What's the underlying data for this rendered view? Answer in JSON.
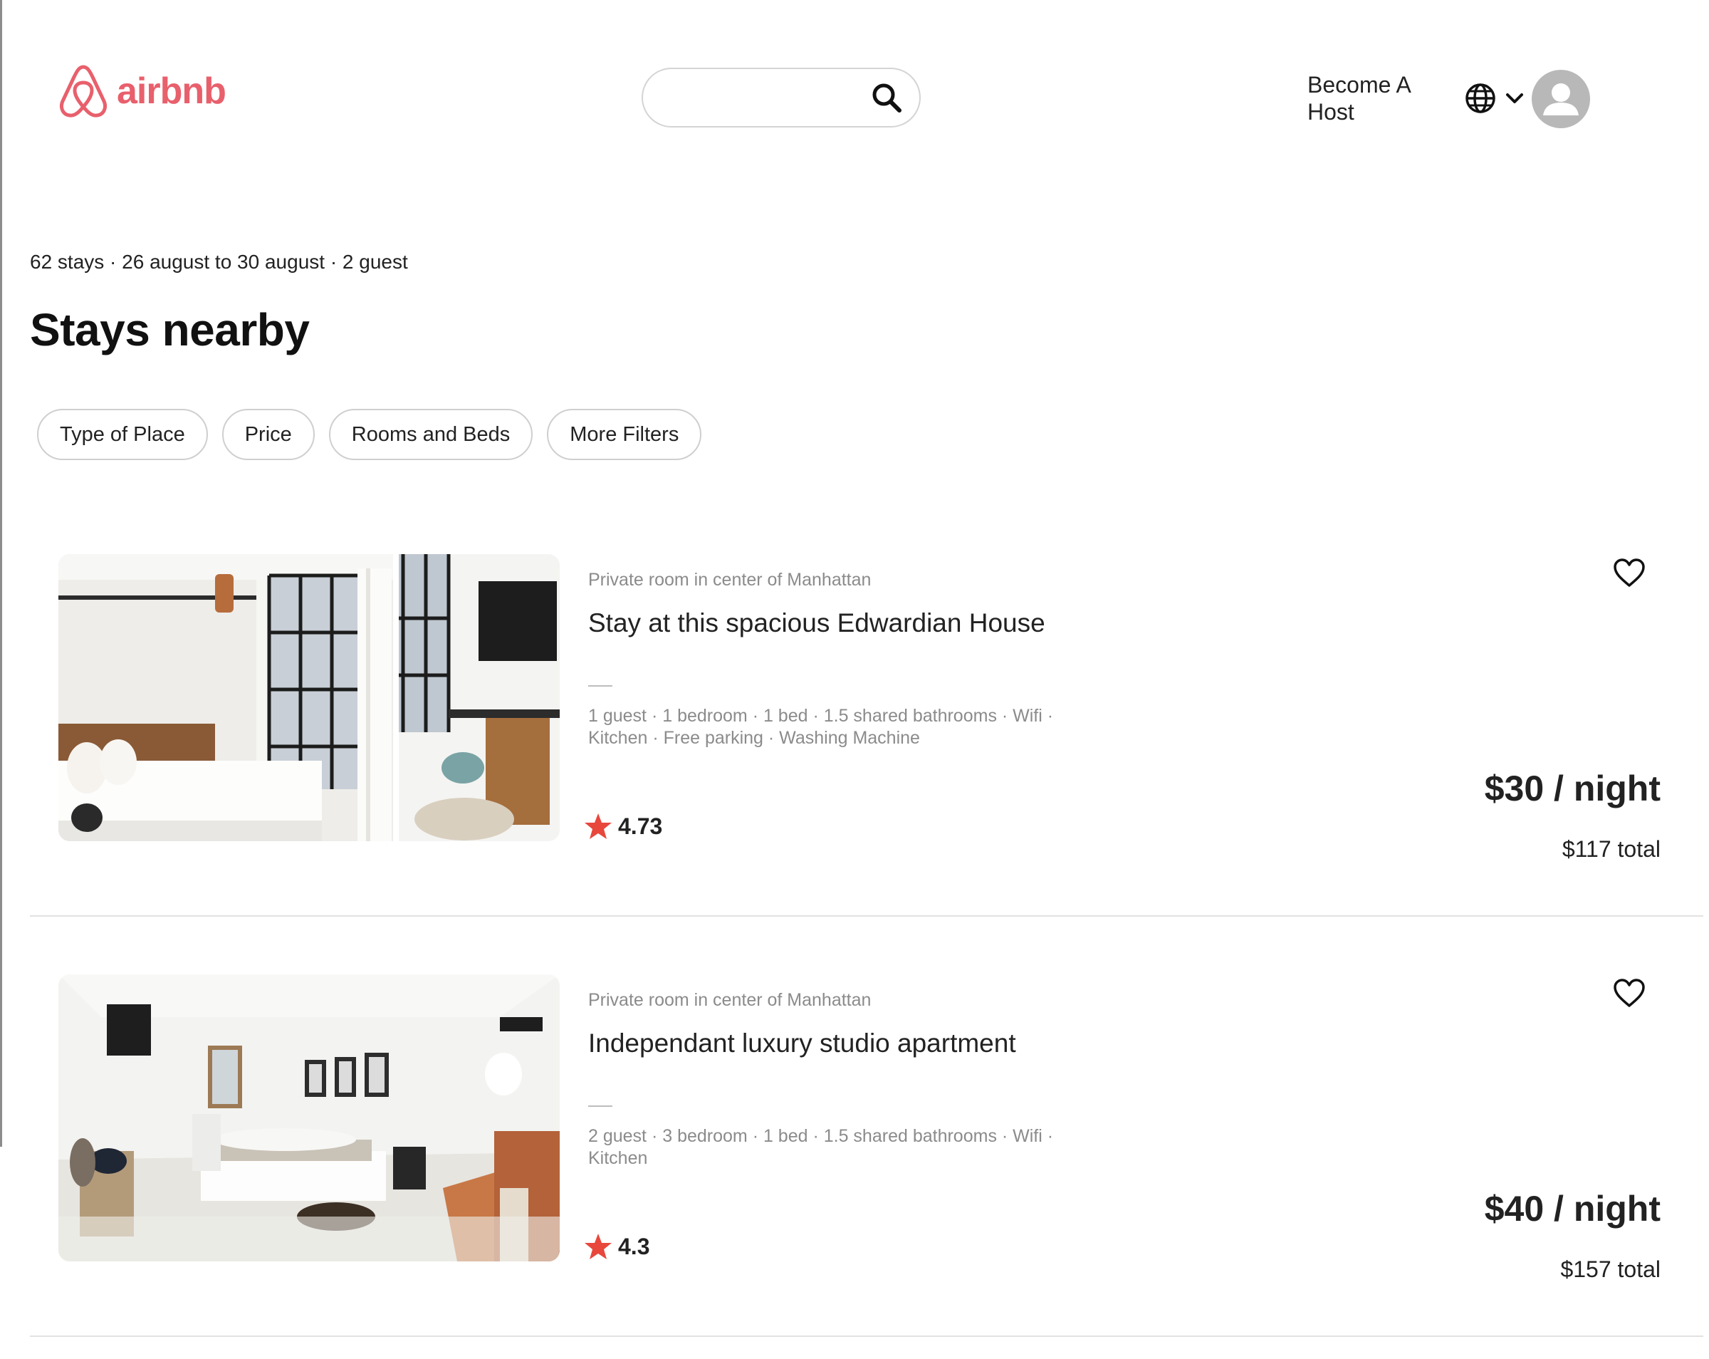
{
  "brand": {
    "name": "airbnb",
    "color": "#e8606c"
  },
  "header": {
    "search": {
      "placeholder": "",
      "icon": "search-icon"
    },
    "become_host": "Become A Host",
    "language_icon": "globe-icon",
    "menu_icon": "chevron-down-icon",
    "profile_icon": "avatar-icon"
  },
  "summary": "62 stays · 26 august to 30 august · 2 guest",
  "title": "Stays nearby",
  "filters": [
    "Type of Place",
    "Price",
    "Rooms and Beds",
    "More Filters"
  ],
  "listings": [
    {
      "type": "Private room in center of Manhattan",
      "title": "Stay at this spacious Edwardian House",
      "amenities": "1 guest · 1 bedroom · 1 bed · 1.5 shared bathrooms · Wifi · Kitchen · Free parking · Washing Machine",
      "rating": "4.73",
      "price": "$30 / night",
      "total": "$117 total"
    },
    {
      "type": "Private room in center of Manhattan",
      "title": "Independant luxury studio apartment",
      "amenities": "2 guest · 3 bedroom · 1 bed · 1.5 shared bathrooms · Wifi · Kitchen",
      "rating": "4.3",
      "price": "$40 / night",
      "total": "$157 total"
    }
  ],
  "colors": {
    "accent": "#e8606c",
    "star": "#e8473c",
    "muted_text": "#8b8b8b"
  }
}
